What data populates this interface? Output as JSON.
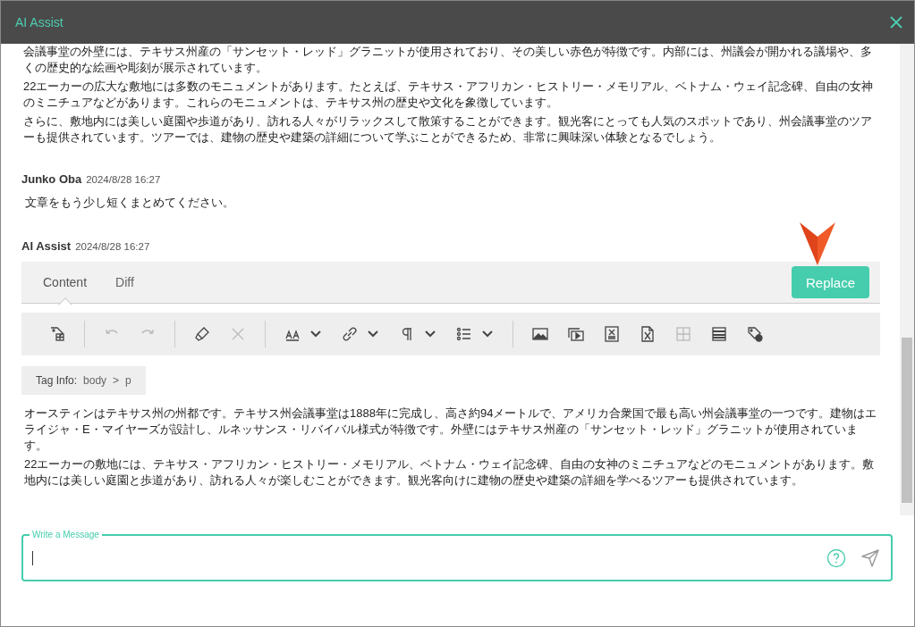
{
  "window": {
    "title": "AI Assist"
  },
  "messages": [
    {
      "kind": "text",
      "paragraphs": [
        "会議事堂の外壁には、テキサス州産の「サンセット・レッド」グラニットが使用されており、その美しい赤色が特徴です。内部には、州議会が開かれる議場や、多くの歴史的な絵画や彫刻が展示されています。",
        "22エーカーの広大な敷地には多数のモニュメントがあります。たとえば、テキサス・アフリカン・ヒストリー・メモリアル、ベトナム・ウェイ記念碑、自由の女神のミニチュアなどがあります。これらのモニュメントは、テキサス州の歴史や文化を象徴しています。",
        "さらに、敷地内には美しい庭園や歩道があり、訪れる人々がリラックスして散策することができます。観光客にとっても人気のスポットであり、州会議事堂のツアーも提供されています。ツアーでは、建物の歴史や建築の詳細について学ぶことができるため、非常に興味深い体験となるでしょう。"
      ]
    },
    {
      "kind": "text",
      "author": "Junko Oba",
      "time": "2024/8/28 16:27",
      "paragraphs": [
        "文章をもう少し短くまとめてください。"
      ]
    },
    {
      "kind": "result",
      "author": "AI Assist",
      "time": "2024/8/28 16:27",
      "tabs": [
        {
          "label": "Content",
          "selected": true
        },
        {
          "label": "Diff",
          "selected": false
        }
      ],
      "replace_button": "Replace",
      "toolbar": [
        [
          {
            "kind": "tag-table",
            "disabled": false,
            "dropdown": false
          }
        ],
        [
          {
            "kind": "undo",
            "disabled": true,
            "dropdown": false
          },
          {
            "kind": "redo",
            "disabled": true,
            "dropdown": false
          }
        ],
        [
          {
            "kind": "eraser",
            "disabled": false,
            "dropdown": false
          },
          {
            "kind": "clear",
            "disabled": true,
            "dropdown": false
          }
        ],
        [
          {
            "kind": "font-size",
            "disabled": false,
            "dropdown": true
          },
          {
            "kind": "link",
            "disabled": false,
            "dropdown": true
          },
          {
            "kind": "paragraph",
            "disabled": false,
            "dropdown": true
          },
          {
            "kind": "list",
            "disabled": false,
            "dropdown": true
          }
        ],
        [
          {
            "kind": "image",
            "disabled": false,
            "dropdown": false
          },
          {
            "kind": "video",
            "disabled": false,
            "dropdown": false
          },
          {
            "kind": "formula",
            "disabled": false,
            "dropdown": false
          },
          {
            "kind": "file",
            "disabled": false,
            "dropdown": false
          },
          {
            "kind": "table",
            "disabled": true,
            "dropdown": false
          },
          {
            "kind": "template",
            "disabled": false,
            "dropdown": false
          },
          {
            "kind": "tag-check",
            "disabled": false,
            "dropdown": false
          }
        ]
      ],
      "tag_info": {
        "label": "Tag Info:",
        "path": [
          "body",
          ">",
          "p"
        ]
      },
      "paragraphs": [
        "オースティンはテキサス州の州都です。テキサス州会議事堂は1888年に完成し、高さ約94メートルで、アメリカ合衆国で最も高い州会議事堂の一つです。建物はエライジャ・E・マイヤーズが設計し、ルネッサンス・リバイバル様式が特徴です。外壁にはテキサス州産の「サンセット・レッド」グラニットが使用されています。",
        "22エーカーの敷地には、テキサス・アフリカン・ヒストリー・メモリアル、ベトナム・ウェイ記念碑、自由の女神のミニチュアなどのモニュメントがあります。敷地内には美しい庭園と歩道があり、訪れる人々が楽しむことができます。観光客向けに建物の歴史や建築の詳細を学べるツアーも提供されています。"
      ]
    }
  ],
  "composer": {
    "label": "Write a Message"
  }
}
